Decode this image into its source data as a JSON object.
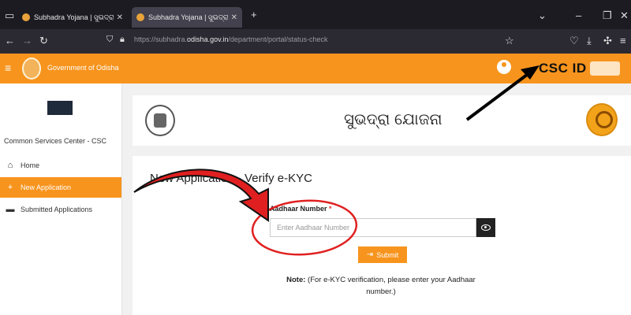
{
  "browser": {
    "tabs": [
      {
        "title": "Subhadra Yojana | ସୁଭଦ୍ରା ଯୋଜନା",
        "active": false
      },
      {
        "title": "Subhadra Yojana | ସୁଭଦ୍ରା ଯୋଜନା",
        "active": true
      }
    ],
    "url_prefix": "https://subhadra.",
    "url_domain": "odisha.gov.in",
    "url_path": "/department/portal/status-check"
  },
  "header": {
    "org_title": "Government of Odisha",
    "csc_id_label": "CSC ID"
  },
  "sidebar": {
    "org_name": "Common Services Center - CSC",
    "items": [
      {
        "label": "Home",
        "icon": "home-icon",
        "active": false
      },
      {
        "label": "New Application",
        "icon": "plus-icon",
        "active": true
      },
      {
        "label": "Submitted Applications",
        "icon": "folder-icon",
        "active": false
      }
    ]
  },
  "banner": {
    "scheme_title": "ସୁଭଦ୍ରା ଯୋଜନା"
  },
  "form": {
    "title": "New Application - Verify e-KYC",
    "aadhaar_label": "Aadhaar Number",
    "required_mark": "*",
    "aadhaar_placeholder": "Enter Aadhaar Number",
    "aadhaar_value": "",
    "submit_label": "Submit",
    "note_label": "Note:",
    "note_text": "(For e-KYC verification, please enter your Aadhaar number.)"
  },
  "colors": {
    "accent": "#f7941d",
    "annotation_red": "#e02020"
  }
}
